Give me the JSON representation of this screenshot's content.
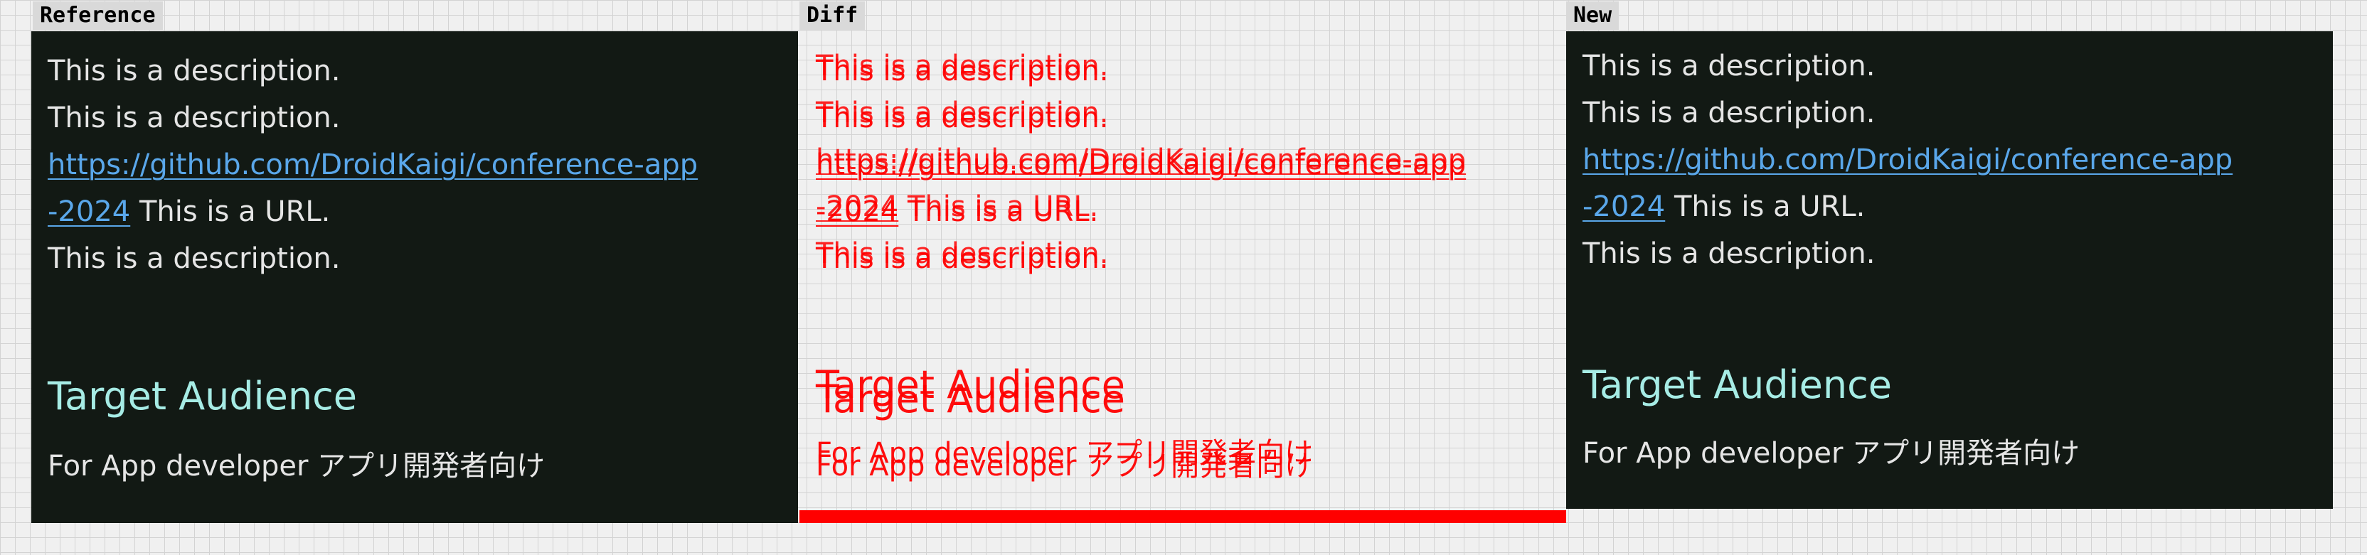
{
  "labels": {
    "reference": "Reference",
    "diff": "Diff",
    "new": "New"
  },
  "colors": {
    "panel_background": "#121914",
    "body_text": "#e5e5e5",
    "link_text": "#5aa7ea",
    "section_title": "#a6ece5",
    "diff_marker": "#ff0000"
  },
  "content": {
    "description": "This is a description.",
    "url_line_1": "https://github.com/DroidKaigi/conference-app",
    "url_line_2": "-2024",
    "url_suffix": " This is a URL.",
    "title": "Target Audience",
    "audience": "For App developer アプリ開発者向け"
  }
}
